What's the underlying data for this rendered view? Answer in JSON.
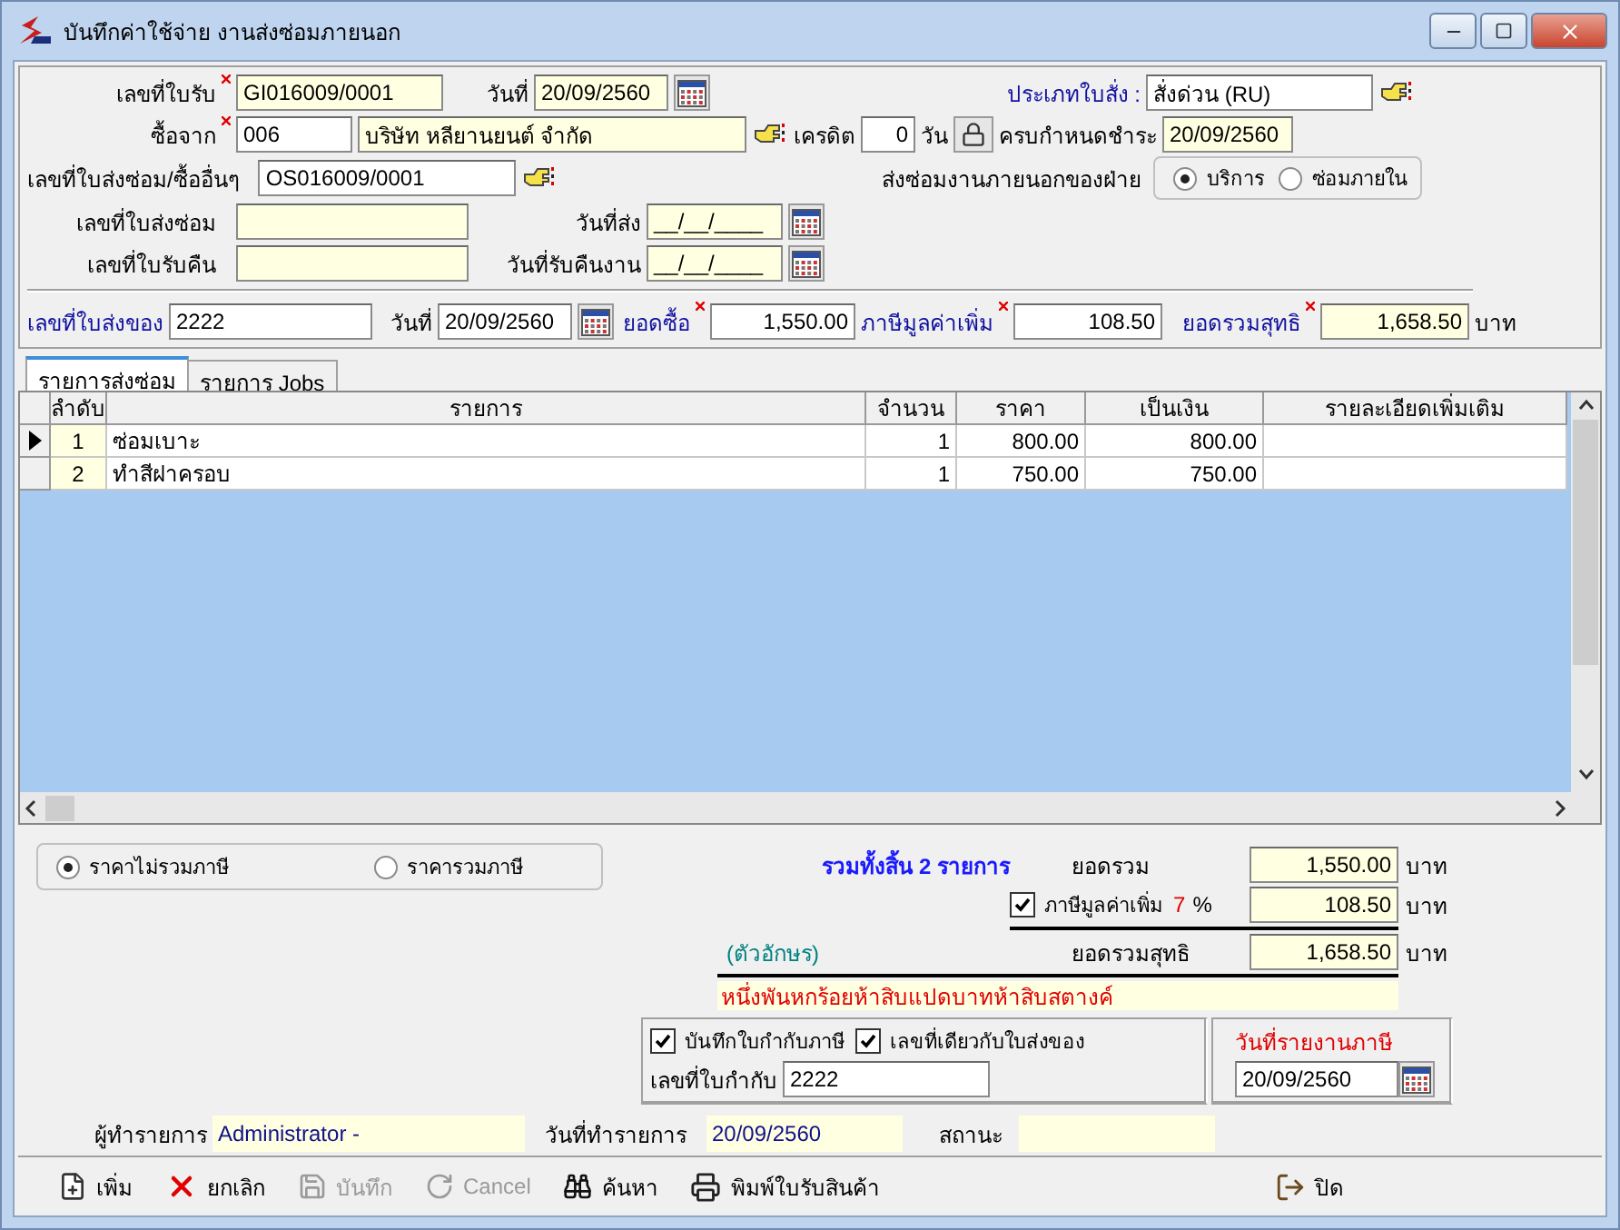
{
  "window": {
    "title": "บันทึกค่าใช้จ่าย งานส่งซ่อมภายนอก"
  },
  "header": {
    "receipt_no": {
      "label": "เลขที่ใบรับ",
      "value": "GI016009/0001",
      "required": true
    },
    "receipt_date": {
      "label": "วันที่",
      "value": "20/09/2560"
    },
    "order_type": {
      "label": "ประเภทใบสั่ง :",
      "value": "สั่งด่วน (RU)"
    },
    "vendor": {
      "label": "ซื้อจาก",
      "code": "006",
      "name": "บริษัท หลียานยนต์ จำกัด",
      "required": true
    },
    "credit": {
      "label": "เครดิต",
      "value": "0",
      "unit": "วัน"
    },
    "due_date": {
      "label": "ครบกำหนดชำระ",
      "value": "20/09/2560"
    },
    "repair_order_no": {
      "label": "เลขที่ใบส่งซ่อม/ซื้ออื่นๆ",
      "value": "OS016009/0001"
    },
    "department": {
      "label": "ส่งซ่อมงานภายนอกของฝ่าย",
      "options": [
        {
          "label": "บริการ",
          "selected": true
        },
        {
          "label": "ซ่อมภายใน",
          "selected": false
        }
      ]
    },
    "repair_doc_no": {
      "label": "เลขที่ใบส่งซ่อม"
    },
    "send_date": {
      "label": "วันที่ส่ง",
      "value": "__/__/____"
    },
    "return_doc_no": {
      "label": "เลขที่ใบรับคืน"
    },
    "return_date": {
      "label": "วันที่รับคืนงาน",
      "value": "__/__/____"
    },
    "delivery_no": {
      "label": "เลขที่ใบส่งของ",
      "value": "2222"
    },
    "delivery_date": {
      "label": "วันที่",
      "value": "20/09/2560"
    },
    "purchase": {
      "label": "ยอดซื้อ",
      "value": "1,550.00",
      "required": true
    },
    "vat": {
      "label": "ภาษีมูลค่าเพิ่ม",
      "value": "108.50",
      "required": true
    },
    "net": {
      "label": "ยอดรวมสุทธิ",
      "value": "1,658.50",
      "unit": "บาท",
      "required": true
    }
  },
  "tabs": [
    {
      "label": "รายการส่งซ่อม",
      "selected": true
    },
    {
      "label": "รายการ Jobs",
      "selected": false
    }
  ],
  "table": {
    "columns": [
      "ลำดับ",
      "รายการ",
      "จำนวน",
      "ราคา",
      "เป็นเงิน",
      "รายละเอียดเพิ่มเติม"
    ],
    "rows": [
      {
        "selected": true,
        "no": "1",
        "item": "ซ่อมเบาะ",
        "qty": "1",
        "price": "800.00",
        "amount": "800.00"
      },
      {
        "selected": false,
        "no": "2",
        "item": "ทำสีฝาครอบ",
        "qty": "1",
        "price": "750.00",
        "amount": "750.00"
      }
    ]
  },
  "price_mode": {
    "options": [
      {
        "label": "ราคาไม่รวมภาษี",
        "selected": true
      },
      {
        "label": "ราคารวมภาษี",
        "selected": false
      }
    ]
  },
  "summary": {
    "count_text": "รวมทั้งสิ้น 2 รายการ",
    "total": {
      "label": "ยอดรวม",
      "value": "1,550.00",
      "unit": "บาท"
    },
    "vat": {
      "label": "ภาษีมูลค่าเพิ่ม",
      "checked": true,
      "rate": "7",
      "percent": "%",
      "value": "108.50",
      "unit": "บาท"
    },
    "net": {
      "label": "ยอดรวมสุทธิ",
      "value": "1,658.50",
      "unit": "บาท"
    },
    "words_label": "(ตัวอักษร)",
    "words": "หนึ่งพันหกร้อยห้าสิบแปดบาทห้าสิบสตางค์"
  },
  "tax_invoice": {
    "save": {
      "label": "บันทึกใบกำกับภาษี",
      "checked": true
    },
    "same_no": {
      "label": "เลขที่เดียวกับใบส่งของ",
      "checked": true
    },
    "invoice_no": {
      "label": "เลขที่ใบกำกับ",
      "value": "2222"
    },
    "report_date": {
      "label": "วันที่รายงานภาษี",
      "value": "20/09/2560"
    }
  },
  "footer": {
    "user": {
      "label": "ผู้ทำรายการ",
      "value": "Administrator -"
    },
    "created": {
      "label": "วันที่ทำรายการ",
      "value": "20/09/2560"
    },
    "status": {
      "label": "สถานะ"
    }
  },
  "toolbar": [
    {
      "kind": "new",
      "label": "เพิ่ม",
      "disabled": false
    },
    {
      "kind": "delete",
      "label": "ยกเลิก",
      "disabled": false
    },
    {
      "kind": "save",
      "label": "บันทึก",
      "disabled": true
    },
    {
      "kind": "cancel",
      "label": "Cancel",
      "disabled": true
    },
    {
      "kind": "search",
      "label": "ค้นหา",
      "disabled": false
    },
    {
      "kind": "print",
      "label": "พิมพ์ใบรับสินค้า",
      "disabled": false
    },
    {
      "kind": "close",
      "label": "ปิด",
      "disabled": false
    }
  ]
}
